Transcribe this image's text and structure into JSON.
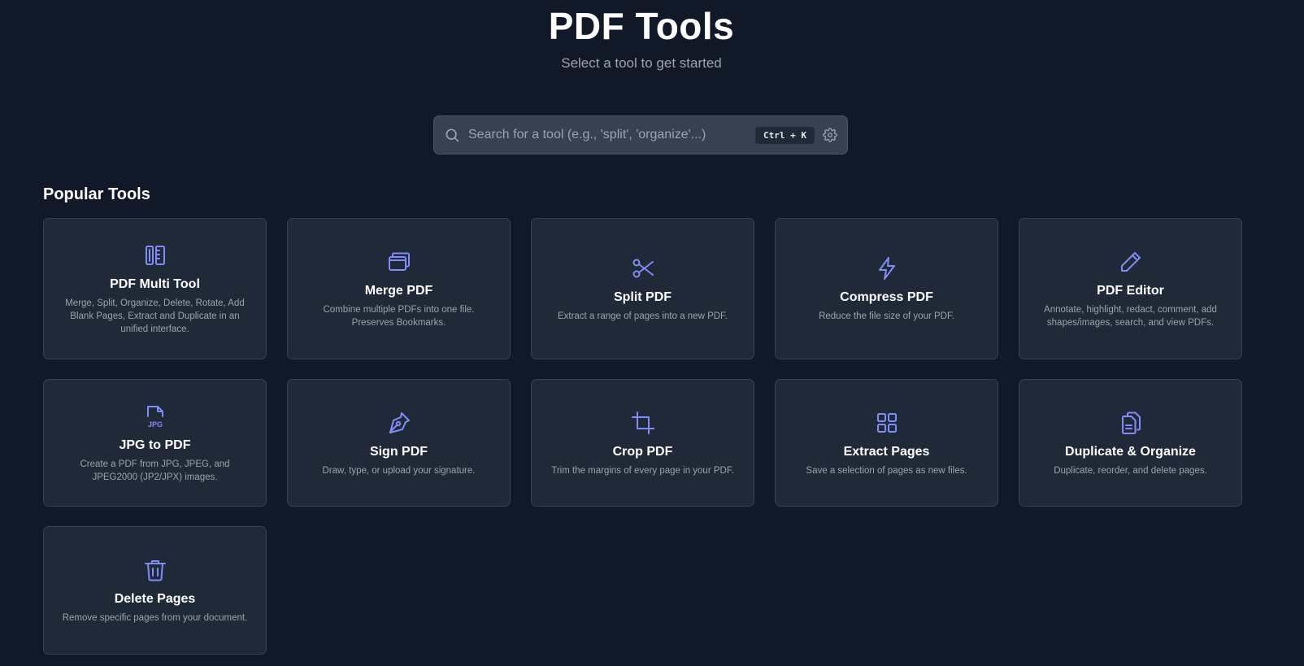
{
  "header": {
    "title": "PDF Tools",
    "subtitle": "Select a tool to get started"
  },
  "search": {
    "placeholder": "Search for a tool (e.g., 'split', 'organize'...)",
    "value": "",
    "shortcut": "Ctrl + K",
    "icon": "search-icon",
    "settings_icon": "gear-icon"
  },
  "popular": {
    "title": "Popular Tools",
    "tools": [
      {
        "name": "PDF Multi Tool",
        "description": "Merge, Split, Organize, Delete, Rotate, Add Blank Pages, Extract and Duplicate in an unified interface.",
        "icon": "multi-tool-icon"
      },
      {
        "name": "Merge PDF",
        "description": "Combine multiple PDFs into one file. Preserves Bookmarks.",
        "icon": "layers-icon"
      },
      {
        "name": "Split PDF",
        "description": "Extract a range of pages into a new PDF.",
        "icon": "scissors-icon"
      },
      {
        "name": "Compress PDF",
        "description": "Reduce the file size of your PDF.",
        "icon": "lightning-icon"
      },
      {
        "name": "PDF Editor",
        "description": "Annotate, highlight, redact, comment, add shapes/images, search, and view PDFs.",
        "icon": "pencil-icon"
      },
      {
        "name": "JPG to PDF",
        "description": "Create a PDF from JPG, JPEG, and JPEG2000 (JP2/JPX) images.",
        "icon": "jpg-file-icon"
      },
      {
        "name": "Sign PDF",
        "description": "Draw, type, or upload your signature.",
        "icon": "pen-nib-icon"
      },
      {
        "name": "Crop PDF",
        "description": "Trim the margins of every page in your PDF.",
        "icon": "crop-icon"
      },
      {
        "name": "Extract Pages",
        "description": "Save a selection of pages as new files.",
        "icon": "grid-icon"
      },
      {
        "name": "Duplicate & Organize",
        "description": "Duplicate, reorder, and delete pages.",
        "icon": "copy-document-icon"
      },
      {
        "name": "Delete Pages",
        "description": "Remove specific pages from your document.",
        "icon": "trash-icon"
      }
    ]
  },
  "colors": {
    "background": "#111827",
    "card": "#1f2937",
    "accent": "#818cf8"
  }
}
